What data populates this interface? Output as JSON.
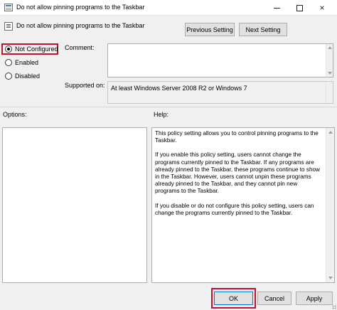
{
  "window": {
    "title": "Do not allow pinning programs to the Taskbar",
    "controls": {
      "minimize": "minimize-icon",
      "maximize": "maximize-icon",
      "close": "×"
    }
  },
  "header": {
    "policy_title": "Do not allow pinning programs to the Taskbar",
    "previous_setting": "Previous Setting",
    "next_setting": "Next Setting"
  },
  "state": {
    "options": [
      "Not Configured",
      "Enabled",
      "Disabled"
    ],
    "selected": "Not Configured"
  },
  "comment": {
    "label": "Comment:",
    "value": ""
  },
  "supported": {
    "label": "Supported on:",
    "value": "At least Windows Server 2008 R2 or Windows 7"
  },
  "options_label": "Options:",
  "help": {
    "label": "Help:",
    "paragraphs": [
      "This policy setting allows you to control pinning programs to the Taskbar.",
      "If you enable this policy setting, users cannot change the programs currently pinned to the Taskbar. If any programs are already pinned to the Taskbar, these programs continue to show in the Taskbar. However, users cannot unpin these programs already pinned to the Taskbar, and they cannot pin new programs to the Taskbar.",
      "If you disable or do not configure this policy setting, users can change the programs currently pinned to the Taskbar."
    ]
  },
  "footer": {
    "ok": "OK",
    "cancel": "Cancel",
    "apply": "Apply"
  },
  "colors": {
    "highlight": "#c8102e",
    "window_bg": "#f0f0f0",
    "ok_border": "#0078d7"
  }
}
